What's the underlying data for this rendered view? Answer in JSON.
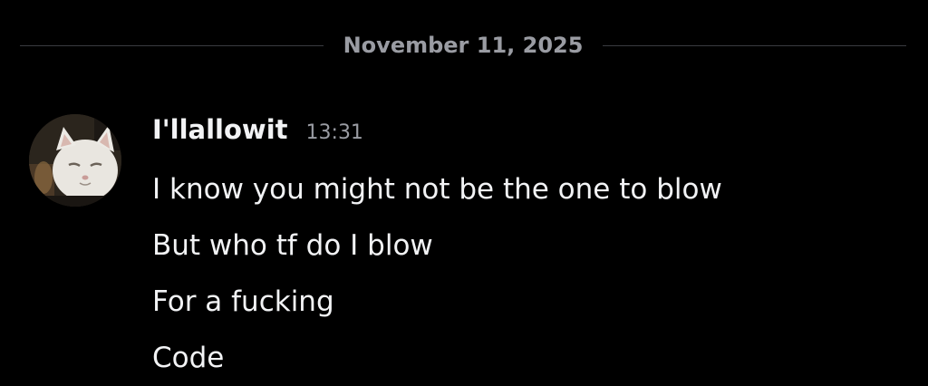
{
  "divider": {
    "date": "November 11, 2025"
  },
  "message": {
    "username": "I'llallowit",
    "timestamp": "13:31",
    "lines": [
      "I know you might not be the one to blow",
      "But who tf do I blow",
      "For a fucking",
      "Code"
    ]
  },
  "colors": {
    "background": "#000000",
    "text": "#f2f3f5",
    "muted": "#9a9ca3",
    "divider_line": "#3a3b40"
  }
}
